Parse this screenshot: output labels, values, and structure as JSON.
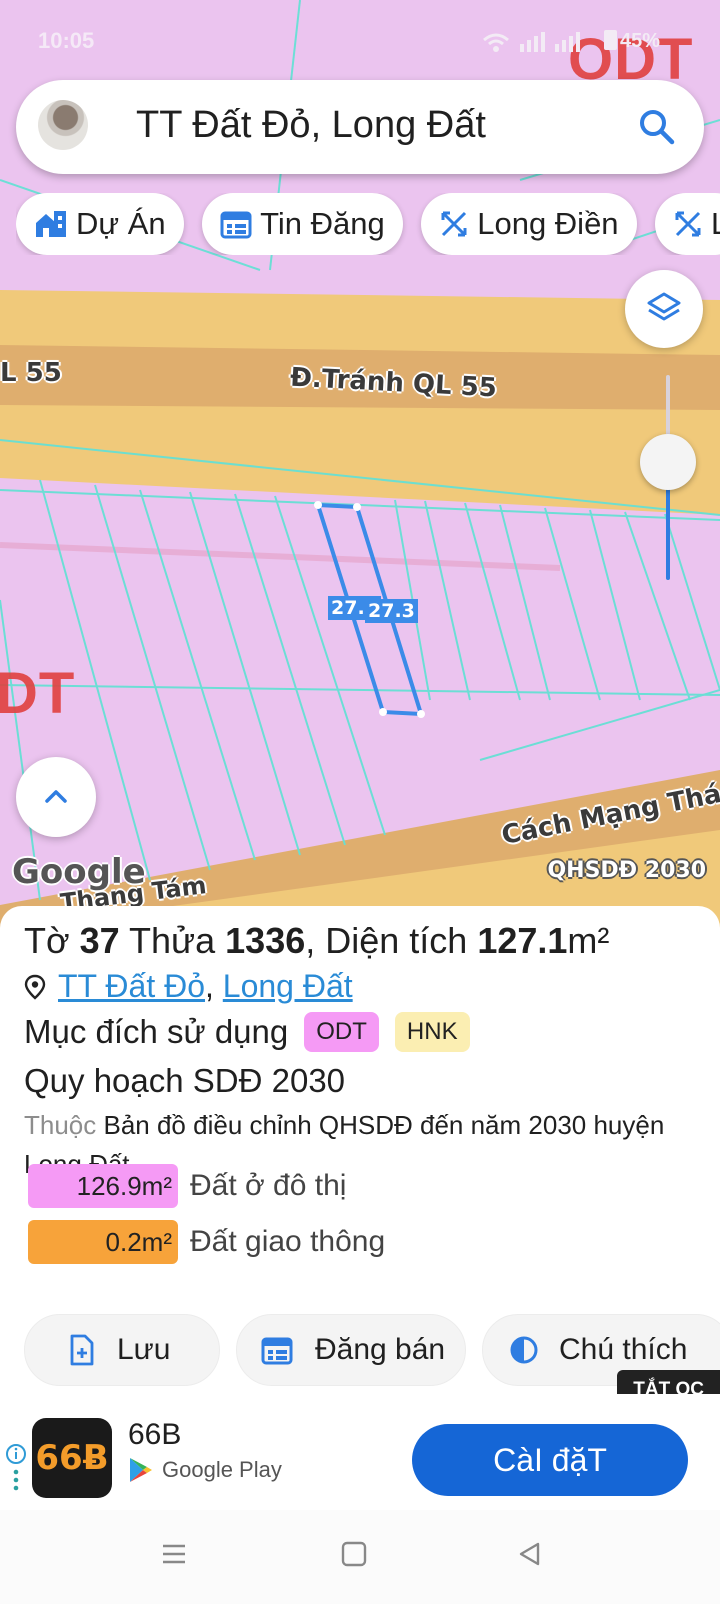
{
  "status_bar": {
    "time": "10:05",
    "battery": "45%"
  },
  "search": {
    "query": "TT Đất Đỏ, Long Đất"
  },
  "chips": [
    {
      "label": "Dự Án",
      "icon": "home-building-icon"
    },
    {
      "label": "Tin Đăng",
      "icon": "listing-icon"
    },
    {
      "label": "Long Điền",
      "icon": "ruler-cross-icon"
    },
    {
      "label": "L",
      "icon": "ruler-cross-icon"
    }
  ],
  "map": {
    "road_label_top": "Đ.Tránh QL 55",
    "road_label_left": "L 55",
    "road_label_bottom": "Cách Mạng Thá",
    "road_label_bottom_left": "Tháng Tám",
    "zone_label_top": "ODT",
    "zone_label_left": "DT",
    "dimension_left": "27.4",
    "dimension_right": "27.3",
    "attribution": "Google",
    "layer_tag": "QHSDĐ 2030",
    "zoom_level": 0.42
  },
  "parcel": {
    "title_prefix": "Tờ ",
    "sheet_no": "37",
    "title_mid": " Thửa ",
    "parcel_no": "1336",
    "title_area_label": ", Diện tích ",
    "area": "127.1",
    "area_unit": "m²",
    "location_town": "TT Đất Đỏ",
    "location_sep": ", ",
    "location_district": "Long Đất",
    "purpose_label": "Mục đích sử dụng",
    "badges": [
      {
        "label": "ODT",
        "color": "#f59af5"
      },
      {
        "label": "HNK",
        "color": "#fbeeb2"
      }
    ],
    "plan_label": "Quy hoạch SDĐ 2030",
    "desc_prefix": "Thuộc",
    "desc_text": " Bản đồ điều chỉnh QHSDĐ đến năm 2030 huyện Long Đất",
    "areas": [
      {
        "value": "126.9m²",
        "label": "Đất ở đô thị",
        "color": "#f59af5"
      },
      {
        "value": "0.2m²",
        "label": "Đất giao thông",
        "color": "#f7a33a"
      }
    ]
  },
  "actions": [
    {
      "label": "Lưu",
      "icon": "save-file-icon"
    },
    {
      "label": "Đăng bán",
      "icon": "calendar-listing-icon"
    },
    {
      "label": "Chú thích",
      "icon": "contrast-icon"
    }
  ],
  "ad_badge": "TẮT QC",
  "ad": {
    "icon_text": "66Ƀ",
    "app_name": "66B",
    "store": "Google Play",
    "install_label": "CàI đặT"
  },
  "colors": {
    "accent": "#1566d6",
    "map_bg": "#ebc4ef",
    "road": "#f0c97a",
    "parcel_line": "#3b8be8"
  }
}
